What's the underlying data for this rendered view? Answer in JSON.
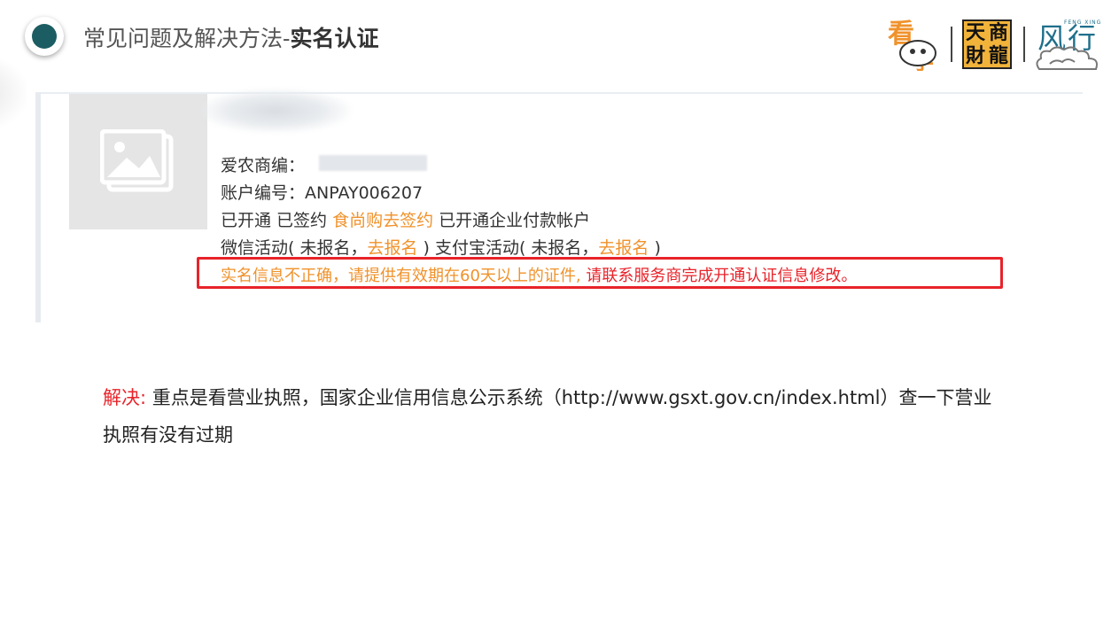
{
  "header": {
    "title_prefix": "常见问题及解决方法-",
    "title_bold": "实名认证"
  },
  "logos": {
    "kan_xue_icon": "kanxue-logo-icon",
    "tsl_chars": [
      "天",
      "商",
      "財",
      "龍"
    ],
    "fx_text": "风行",
    "fx_small": "FENG XING"
  },
  "record": {
    "merchant_label": "爱农商编：",
    "account_label": "账户编号：ANPAY006207",
    "status_line": {
      "part1": "已开通 已签约 ",
      "link": "食尚购去签约",
      "part2": " 已开通企业付款帐户"
    },
    "activity_line": {
      "part1": "微信活动( 未报名，",
      "link1": "去报名",
      "part2": " ) 支付宝活动( 未报名，",
      "link2": "去报名",
      "part3": " )"
    },
    "alert": {
      "orange": "实名信息不正确，请提供有效期在60天以上的证件,",
      "red": " 请联系服务商完成开通认证信息修改。"
    }
  },
  "solution": {
    "label": "解决:",
    "text": "  重点是看营业执照，国家企业信用信息公示系统（http://www.gsxt.gov.cn/index.html）查一下营业执照有没有过期"
  }
}
